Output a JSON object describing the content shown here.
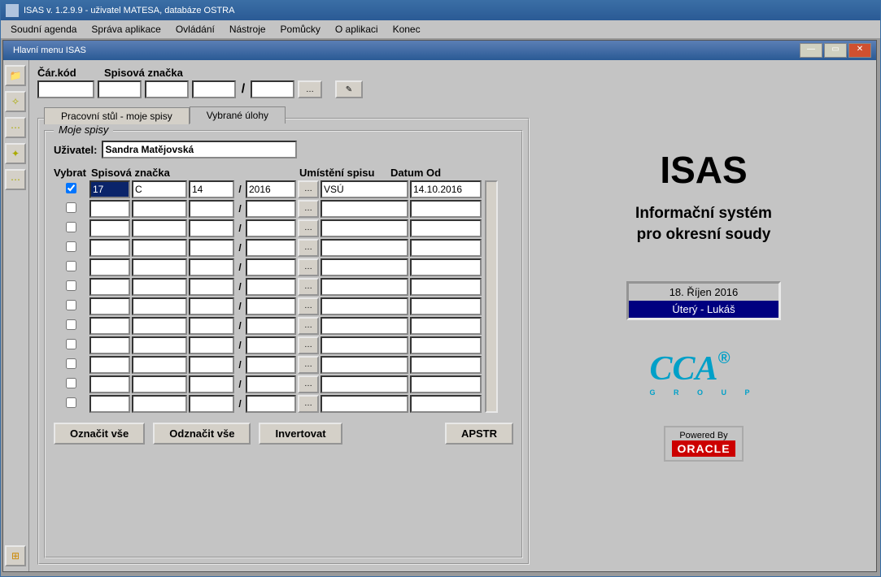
{
  "app_title": "ISAS v. 1.2.9.9 - uživatel MATESA, databáze OSTRA",
  "menu": [
    "Soudní agenda",
    "Správa aplikace",
    "Ovládání",
    "Nástroje",
    "Pomůcky",
    "O aplikaci",
    "Konec"
  ],
  "inner_title": "Hlavní menu ISAS",
  "top": {
    "carkod_label": "Čár.kód",
    "spis_label": "Spisová značka"
  },
  "tabs": {
    "tab1": "Pracovní stůl - moje spisy",
    "tab2": "Vybrané úlohy"
  },
  "section_title": "Moje spisy",
  "user_label": "Uživatel:",
  "user_value": "Sandra Matějovská",
  "cols": {
    "vybrat": "Vybrat",
    "spis": "Spisová značka",
    "umist": "Umístění spisu",
    "datum": "Datum Od"
  },
  "row0": {
    "f1": "17",
    "f2": "C",
    "f3": "14",
    "f4": "2016",
    "loc": "VSÚ",
    "date": "14.10.2016"
  },
  "buttons": {
    "oznacit": "Označit vše",
    "odznacit": "Odznačit vše",
    "invert": "Invertovat",
    "apstr": "APSTR"
  },
  "brand": "ISAS",
  "sub1": "Informační systém",
  "sub2": "pro okresní soudy",
  "date_line": "18. Říjen    2016",
  "day_line": "Úterý - Lukáš",
  "oracle_top": "Powered By",
  "oracle": "ORACLE",
  "cca_sub": "G R O U P"
}
